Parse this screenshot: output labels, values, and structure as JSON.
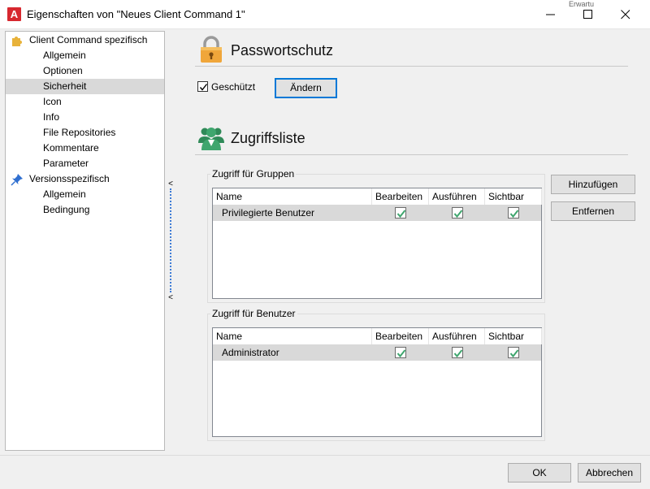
{
  "window": {
    "title": "Eigenschaften von \"Neues Client Command 1\"",
    "app_icon_letter": "A",
    "background_peek": "Erwartu"
  },
  "tree": {
    "items": [
      {
        "label": "Client Command spezifisch",
        "level": 0,
        "icon": "puzzle-icon"
      },
      {
        "label": "Allgemein",
        "level": 1
      },
      {
        "label": "Optionen",
        "level": 1
      },
      {
        "label": "Sicherheit",
        "level": 1,
        "selected": true
      },
      {
        "label": "Icon",
        "level": 1
      },
      {
        "label": "Info",
        "level": 1
      },
      {
        "label": "File Repositories",
        "level": 1
      },
      {
        "label": "Kommentare",
        "level": 1
      },
      {
        "label": "Parameter",
        "level": 1
      },
      {
        "label": "Versionsspezifisch",
        "level": 0,
        "icon": "pin-icon"
      },
      {
        "label": "Allgemein",
        "level": 1
      },
      {
        "label": "Bedingung",
        "level": 1
      }
    ]
  },
  "splitter": {
    "arrow_top": "<",
    "arrow_bottom": "<"
  },
  "password": {
    "title": "Passwortschutz",
    "icon": "padlock-icon",
    "protected_label": "Geschützt",
    "protected_checked": true,
    "change_button": "Ändern"
  },
  "access": {
    "title": "Zugriffsliste",
    "icon": "users-icon",
    "add_button": "Hinzufügen",
    "remove_button": "Entfernen",
    "groups": {
      "title": "Zugriff für Gruppen",
      "columns": [
        "Name",
        "Bearbeiten",
        "Ausführen",
        "Sichtbar"
      ],
      "rows": [
        {
          "name": "Privilegierte Benutzer",
          "edit": true,
          "execute": true,
          "visible": true
        }
      ]
    },
    "users": {
      "title": "Zugriff für Benutzer",
      "columns": [
        "Name",
        "Bearbeiten",
        "Ausführen",
        "Sichtbar"
      ],
      "rows": [
        {
          "name": "Administrator",
          "edit": true,
          "execute": true,
          "visible": true
        }
      ]
    }
  },
  "footer": {
    "ok_button": "OK",
    "cancel_button": "Abbrechen"
  },
  "colors": {
    "accent": "#0078d7",
    "check": "#3fa66e",
    "padlock": "#f0a63a",
    "users_icon": "#3fa66e",
    "app_icon": "#d7282f"
  }
}
